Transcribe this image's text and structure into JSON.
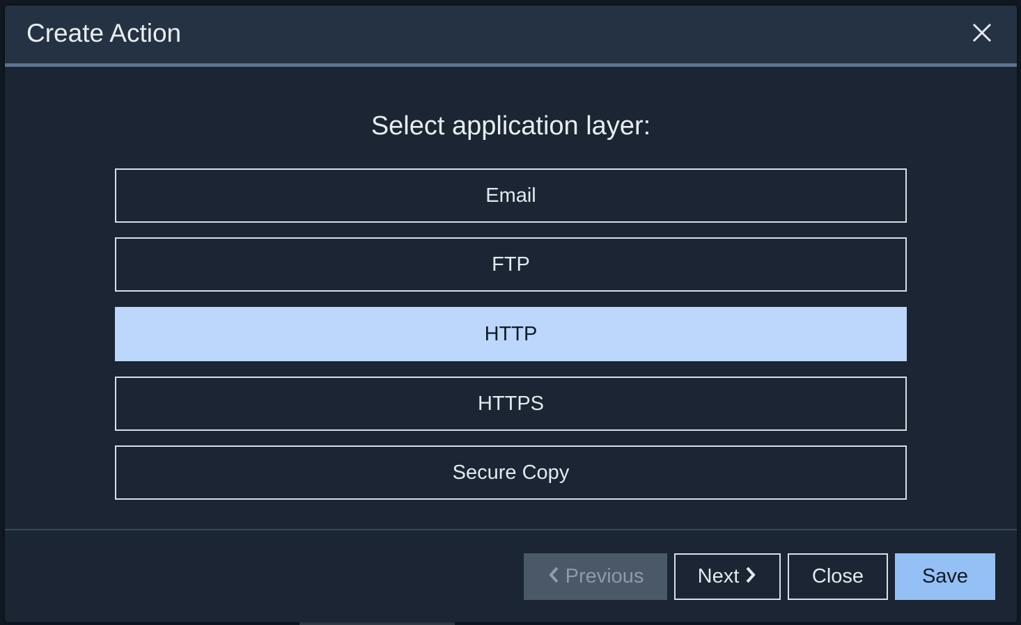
{
  "modal": {
    "title": "Create Action",
    "close_icon": "close-icon",
    "prompt": "Select application layer:",
    "options": [
      {
        "label": "Email",
        "selected": false
      },
      {
        "label": "FTP",
        "selected": false
      },
      {
        "label": "HTTP",
        "selected": true
      },
      {
        "label": "HTTPS",
        "selected": false
      },
      {
        "label": "Secure Copy",
        "selected": false
      }
    ],
    "footer": {
      "previous_label": "Previous",
      "previous_icon": "chevron-left-icon",
      "previous_disabled": true,
      "next_label": "Next",
      "next_icon": "chevron-right-icon",
      "close_label": "Close",
      "save_label": "Save"
    }
  },
  "colors": {
    "header_bg": "#253243",
    "header_accent": "#5e7490",
    "body_bg": "#1b2533",
    "selected_option": "#bcd7fb",
    "save_button": "#94c0f6",
    "disabled_button": "#4a5868"
  }
}
